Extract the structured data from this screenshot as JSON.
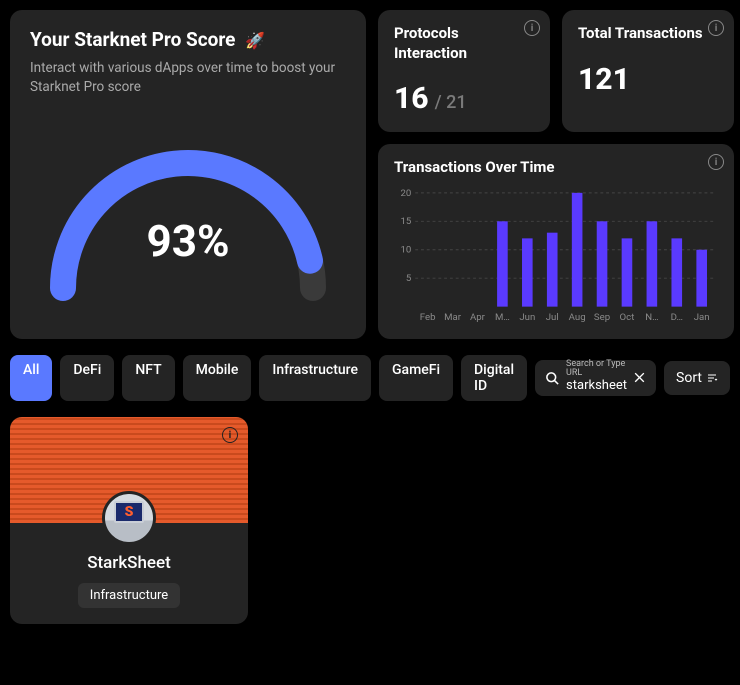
{
  "score_card": {
    "title": "Your Starknet Pro Score",
    "rocket": "🚀",
    "subtitle": "Interact with various dApps over time to boost your Starknet Pro score",
    "value": "93%",
    "percent": 93
  },
  "stats": {
    "protocols": {
      "label": "Protocols Interaction",
      "value": "16",
      "total": "/ 21"
    },
    "transactions": {
      "label": "Total Transactions",
      "value": "121"
    }
  },
  "chart_title": "Transactions Over Time",
  "chart_data": {
    "type": "bar",
    "categories": [
      "Feb",
      "Mar",
      "Apr",
      "M…",
      "Jun",
      "Jul",
      "Aug",
      "Sep",
      "Oct",
      "N…",
      "D…",
      "Jan"
    ],
    "values": [
      0,
      0,
      0,
      15,
      12,
      13,
      20,
      15,
      12,
      15,
      12,
      10
    ],
    "ylim": [
      0,
      20
    ],
    "yticks": [
      5,
      10,
      15,
      20
    ],
    "title": "Transactions Over Time",
    "xlabel": "",
    "ylabel": ""
  },
  "filters": [
    "All",
    "DeFi",
    "NFT",
    "Mobile",
    "Infrastructure",
    "GameFi",
    "Digital ID"
  ],
  "filter_active_index": 0,
  "search": {
    "placeholder": "Search or Type URL",
    "value": "starksheet"
  },
  "sort": {
    "label": "Sort"
  },
  "result": {
    "name": "StarkSheet",
    "tag": "Infrastructure",
    "avatar_letter": "S"
  },
  "colors": {
    "accent": "#5a79ff",
    "bar": "#5a3aff"
  }
}
